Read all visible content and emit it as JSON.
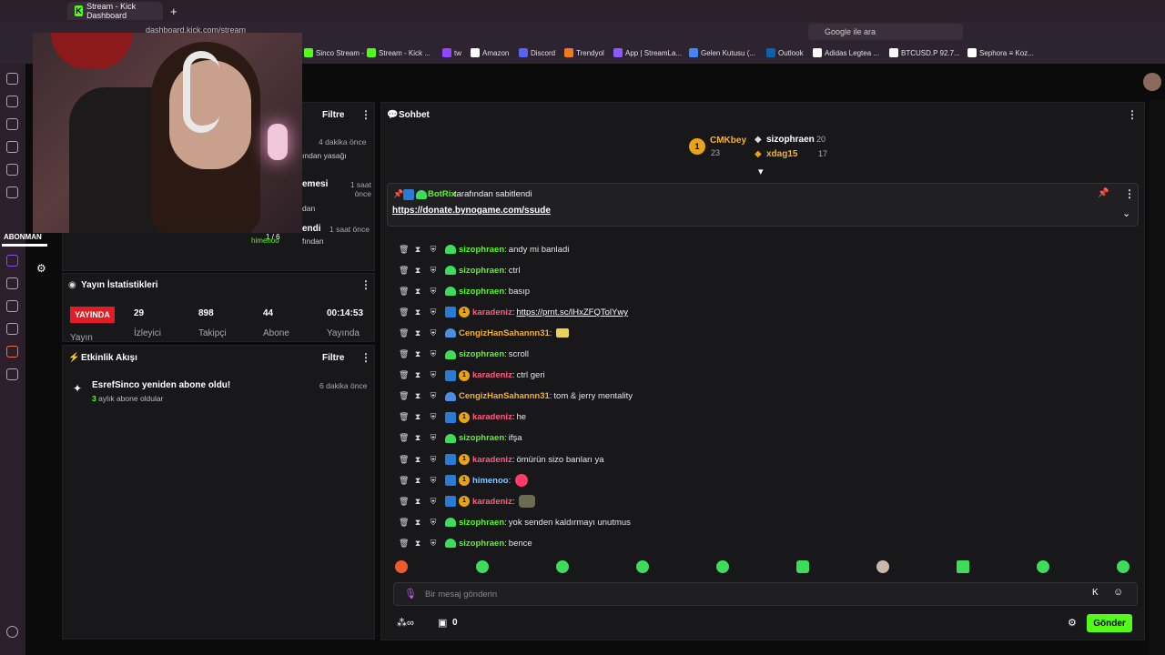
{
  "browser": {
    "active_tab": "Stream - Kick Dashboard",
    "url": "dashboard.kick.com/stream",
    "search_placeholder": "Google ile ara",
    "bookmarks": [
      {
        "label": "Sinco Stream - ...",
        "color": "#53fc18"
      },
      {
        "label": "Stream - Kick ...",
        "color": "#53fc18"
      },
      {
        "label": "tw",
        "color": "#9146ff"
      },
      {
        "label": "Amazon",
        "color": "#ffffff"
      },
      {
        "label": "Discord",
        "color": "#5865f2"
      },
      {
        "label": "Trendyol",
        "color": "#f27a1a"
      },
      {
        "label": "App | StreamLa...",
        "color": "#8a5cff"
      },
      {
        "label": "Gelen Kutusu (...",
        "color": "#4285f4"
      },
      {
        "label": "Outlook",
        "color": "#0a64ad"
      },
      {
        "label": "Adidas Legtea ...",
        "color": "#ffffff"
      },
      {
        "label": "BTCUSD.P 92.7...",
        "color": "#ffffff"
      },
      {
        "label": "Sephora ≡ Koz...",
        "color": "#ffffff"
      }
    ]
  },
  "overlay": {
    "label": "ABONMAN",
    "progress": "1 / 6",
    "progress_user": "himehoo"
  },
  "moderation_panel": {
    "title": "Filtre",
    "items": [
      {
        "time": "4 dakika önce",
        "text": "ından yasağı"
      },
      {
        "title": "emesi",
        "time": "1 saat önce",
        "text": "dan"
      },
      {
        "title": "endi",
        "time": "1 saat önce",
        "text": "fından"
      }
    ]
  },
  "stats": {
    "title": "Yayın İstatistikleri",
    "live_badge": "YAYINDA",
    "live_caption": "Yayın",
    "viewers": "29",
    "viewers_label": "İzleyici",
    "followers": "898",
    "followers_label": "Takipçi",
    "subs": "44",
    "subs_label": "Abone",
    "uptime": "00:14:53",
    "uptime_label": "Yayında"
  },
  "activity": {
    "title": "Etkinlik Akışı",
    "filter": "Filtre",
    "event_title": "EsrefSinco yeniden abone oldu!",
    "event_months": "3",
    "event_sub": "aylık abone oldular",
    "event_time": "6 dakika önce"
  },
  "chat": {
    "title": "Sohbet",
    "leaderboard": [
      {
        "name": "CMKbey",
        "count": "23"
      },
      {
        "name": "sizophraen",
        "count": "20"
      },
      {
        "name": "xdag15",
        "count": "17"
      }
    ],
    "pinned_by": "BotRix",
    "pinned_suffix": "tarafından sabitlendi",
    "pinned_link": "https://donate.bynogame.com/ssude",
    "messages": [
      {
        "user": "sizophraen",
        "cls": "green",
        "badges": "g",
        "text": "andy mi banladi"
      },
      {
        "user": "sizophraen",
        "cls": "green",
        "badges": "g",
        "text": "ctrl"
      },
      {
        "user": "sizophraen",
        "cls": "green",
        "badges": "g",
        "text": "basıp"
      },
      {
        "user": "karadeniz",
        "cls": "pink",
        "badges": "bo",
        "text": "https://prnt.sc/lHxZFQTolYwy",
        "link": true
      },
      {
        "user": "CengizHanSahannn31",
        "cls": "gold",
        "badges": "c",
        "text": ""
      },
      {
        "user": "sizophraen",
        "cls": "green",
        "badges": "g",
        "text": "scroll"
      },
      {
        "user": "karadeniz",
        "cls": "pink",
        "badges": "bo",
        "text": "ctrl geri"
      },
      {
        "user": "CengizHanSahannn31",
        "cls": "gold",
        "badges": "c",
        "text": "tom & jerry mentality"
      },
      {
        "user": "karadeniz",
        "cls": "pink",
        "badges": "bo",
        "text": "he"
      },
      {
        "user": "sizophraen",
        "cls": "green",
        "badges": "g",
        "text": "ifşa"
      },
      {
        "user": "karadeniz",
        "cls": "pink",
        "badges": "bo",
        "text": "ömürün sizo banları ya"
      },
      {
        "user": "himenoo",
        "cls": "blue",
        "badges": "bo",
        "text": ""
      },
      {
        "user": "karadeniz",
        "cls": "pink",
        "badges": "bo",
        "text": ""
      },
      {
        "user": "sizophraen",
        "cls": "green",
        "badges": "g",
        "text": "yok senden kaldırmayı unutmus"
      },
      {
        "user": "sizophraen",
        "cls": "green",
        "badges": "g",
        "text": "bence"
      }
    ],
    "input_placeholder": "Bir mesaj gönderin",
    "viewers_count": "0",
    "send_label": "Gönder"
  }
}
